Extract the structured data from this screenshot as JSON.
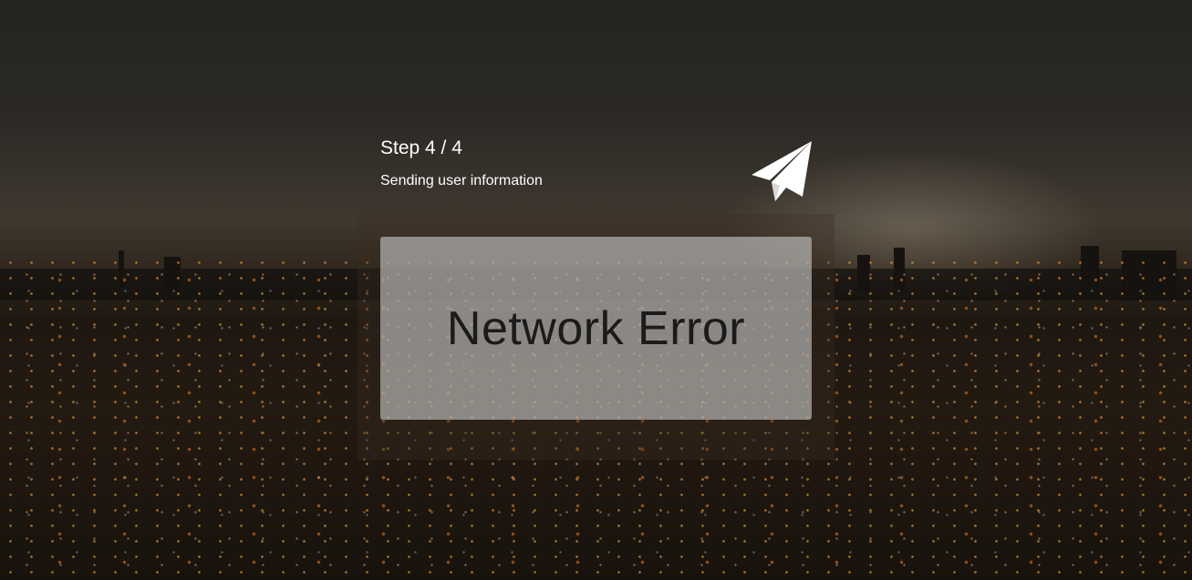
{
  "step": {
    "title": "Step 4 / 4",
    "subtitle": "Sending user information"
  },
  "icon": {
    "name": "paper-plane-icon",
    "color": "#ffffff"
  },
  "error": {
    "message": "Network Error"
  }
}
